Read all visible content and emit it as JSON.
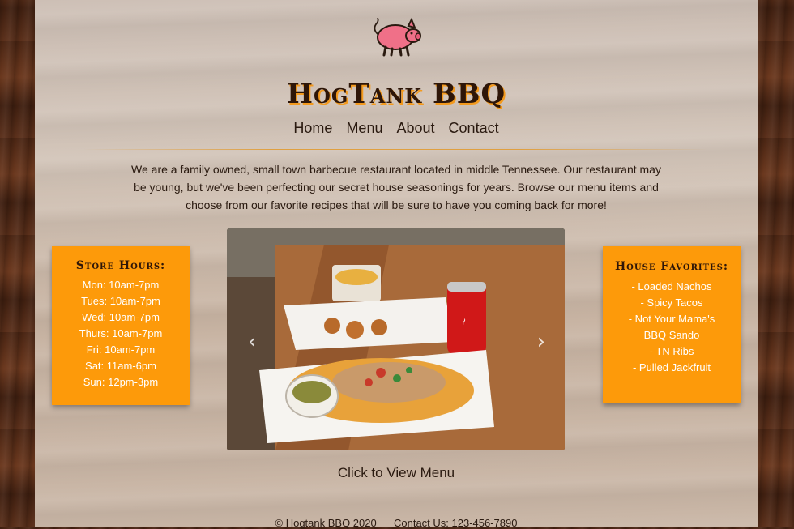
{
  "header": {
    "title": "HogTank BBQ",
    "logo_icon": "pig-icon"
  },
  "nav": {
    "items": [
      "Home",
      "Menu",
      "About",
      "Contact"
    ]
  },
  "intro": {
    "text": "We are a family owned, small town barbecue restaurant located in middle Tennessee. Our restaurant may be young, but we've been perfecting our secret house seasonings for years. Browse our menu items and choose from our favorite recipes that will be sure to have you coming back for more!"
  },
  "store_hours": {
    "title": "Store Hours:",
    "lines": [
      "Mon: 10am-7pm",
      "Tues: 10am-7pm",
      "Wed: 10am-7pm",
      "Thurs: 10am-7pm",
      "Fri: 10am-7pm",
      "Sat: 11am-6pm",
      "Sun: 12pm-3pm"
    ]
  },
  "favorites": {
    "title": "House Favorites:",
    "lines": [
      "- Loaded Nachos",
      "- Spicy Tacos",
      "- Not Your Mama's BBQ Sando",
      "- TN Ribs",
      "- Pulled Jackfruit"
    ]
  },
  "carousel": {
    "prev_icon": "chevron-left-icon",
    "next_icon": "chevron-right-icon",
    "prev_glyph": "‹",
    "next_glyph": "›"
  },
  "view_menu": "Click to View Menu",
  "footer": {
    "copyright": "© Hogtank BBQ 2020",
    "contact": "Contact Us:  123-456-7890"
  },
  "colors": {
    "accent": "#fd9a0a",
    "title": "#2e1608",
    "pig": "#f07088"
  }
}
